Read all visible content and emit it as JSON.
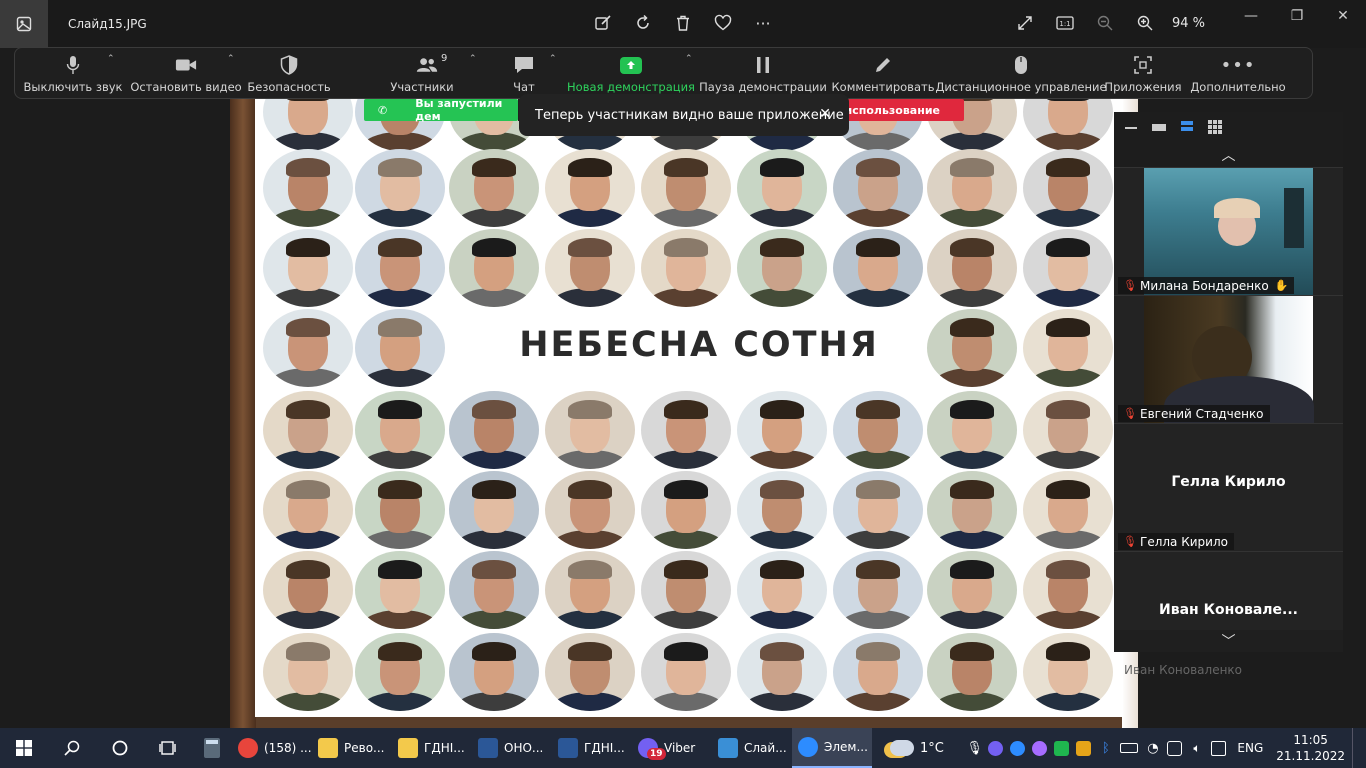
{
  "window": {
    "title": "Слайд15.JPG",
    "zoom": "94 %"
  },
  "toolbar": {
    "participants_count": "9",
    "items": [
      {
        "label": "Выключить звук"
      },
      {
        "label": "Остановить видео"
      },
      {
        "label": "Безопасность"
      },
      {
        "label": "Участники"
      },
      {
        "label": "Чат"
      },
      {
        "label": "Новая демонстрация"
      },
      {
        "label": "Пауза демонстрации"
      },
      {
        "label": "Комментировать"
      },
      {
        "label": "Дистанционное управление"
      },
      {
        "label": "Приложения"
      },
      {
        "label": "Дополнительно"
      }
    ]
  },
  "share": {
    "green_banner": "Вы запустили дем",
    "red_banner": "использование",
    "toast": "Теперь участникам видно ваше приложение"
  },
  "slide": {
    "title": "НЕБЕСНА СОТНЯ"
  },
  "participants": [
    {
      "name": "Милана Бондаренко"
    },
    {
      "name": "Евгений Стадченко"
    },
    {
      "display": "Гелла Кирило",
      "name": "Гелла Кирило"
    },
    {
      "display": "Иван  Коновале...",
      "name": "Иван Коноваленко"
    }
  ],
  "taskbar": {
    "apps": [
      {
        "label": "(158) ...",
        "icon": "chrome-icon",
        "color": "#e8453c"
      },
      {
        "label": "Рево...",
        "icon": "folder-icon",
        "color": "#f3c94b"
      },
      {
        "label": "ГДНІ...",
        "icon": "folder-icon",
        "color": "#f3c94b"
      },
      {
        "label": "ОНО...",
        "icon": "word-icon",
        "color": "#2b5797"
      },
      {
        "label": "ГДНІ...",
        "icon": "word-icon",
        "color": "#2b5797"
      },
      {
        "label": "Viber",
        "icon": "viber-icon",
        "color": "#7360f2",
        "badge": "19"
      },
      {
        "label": "Слай...",
        "icon": "photos-icon",
        "color": "#3a8fd6"
      },
      {
        "label": "Элем...",
        "icon": "zoom-icon",
        "color": "#2d8cff"
      }
    ],
    "weather": "1°C",
    "language": "ENG",
    "time": "11:05",
    "date": "21.11.2022"
  }
}
